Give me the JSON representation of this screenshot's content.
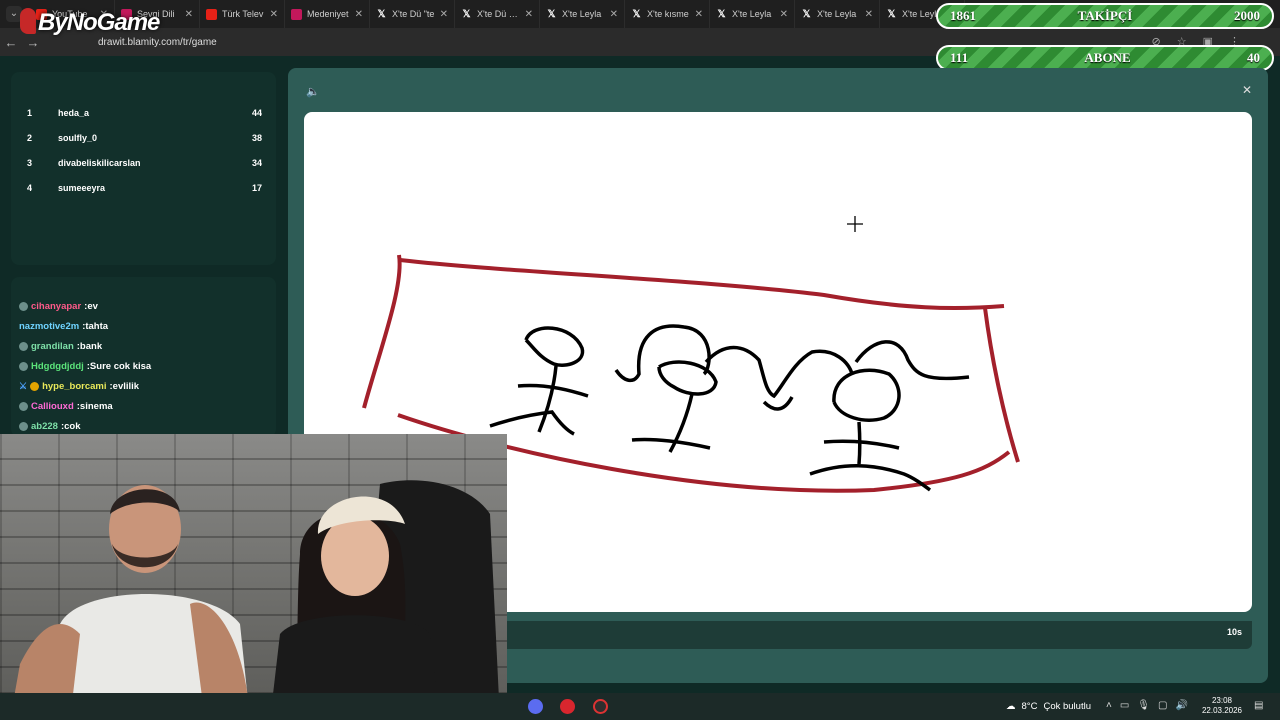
{
  "browser": {
    "tabs": [
      {
        "label": "YouTube",
        "favicon": "youtube-icon"
      },
      {
        "label": "Sevgi Dili",
        "favicon": "red-icon"
      },
      {
        "label": "Türk Telev",
        "favicon": "youtube-icon"
      },
      {
        "label": "Medeniyet",
        "favicon": "red-icon"
      },
      {
        "label": "X'te Dü \"te",
        "favicon": "x-icon"
      },
      {
        "label": "X'te Dü \"Sı",
        "favicon": "x-icon"
      },
      {
        "label": "X'te Leyla",
        "favicon": "x-icon"
      },
      {
        "label": "X'te kısme",
        "favicon": "x-icon"
      },
      {
        "label": "X'te Leyla",
        "favicon": "x-icon"
      },
      {
        "label": "X'te Leyla",
        "favicon": "x-icon"
      },
      {
        "label": "X'te Leyla",
        "favicon": "x-icon"
      }
    ],
    "url": "drawit.blamity.com/tr/game"
  },
  "overlay": {
    "logo": "ByNoGame",
    "followers": {
      "current": "1861",
      "label": "TAKİPÇİ",
      "goal": "2000"
    },
    "subscribers": {
      "current": "111",
      "label": "ABONE",
      "goal": "40"
    }
  },
  "leaderboard": [
    {
      "rank": "1",
      "name": "heda_a",
      "score": "44"
    },
    {
      "rank": "2",
      "name": "soulfly_0",
      "score": "38"
    },
    {
      "rank": "3",
      "name": "divabeliskilicarslan",
      "score": "34"
    },
    {
      "rank": "4",
      "name": "sumeeeyra",
      "score": "17"
    }
  ],
  "chat": [
    {
      "user": "cihanyapar",
      "msg": ":ev",
      "color": "#ff5a8a",
      "badge": "shield"
    },
    {
      "user": "nazmotive2m",
      "msg": ":tahta",
      "color": "#6fd3ff",
      "badge": "none"
    },
    {
      "user": "grandilan",
      "msg": ":bank",
      "color": "#7ee0a8",
      "badge": "shield"
    },
    {
      "user": "Hdgdgdjddj",
      "msg": ":Sure cok kisa",
      "color": "#5be37a",
      "badge": "shield"
    },
    {
      "user": "hype_borcami",
      "msg": ":evlilik",
      "color": "#e9e95a",
      "badge": "sword"
    },
    {
      "user": "Calliouxd",
      "msg": ":sinema",
      "color": "#ff6ad5",
      "badge": "shield"
    },
    {
      "user": "ab228",
      "msg": ":cok",
      "color": "#7ee0a8",
      "badge": "shield"
    }
  ],
  "game": {
    "timer_label": "10s",
    "timer_progress": 0.036
  },
  "taskbar": {
    "temperature": "8°C",
    "weather": "Çok bulutlu",
    "time": "23:08",
    "date": "22.03.2026"
  }
}
